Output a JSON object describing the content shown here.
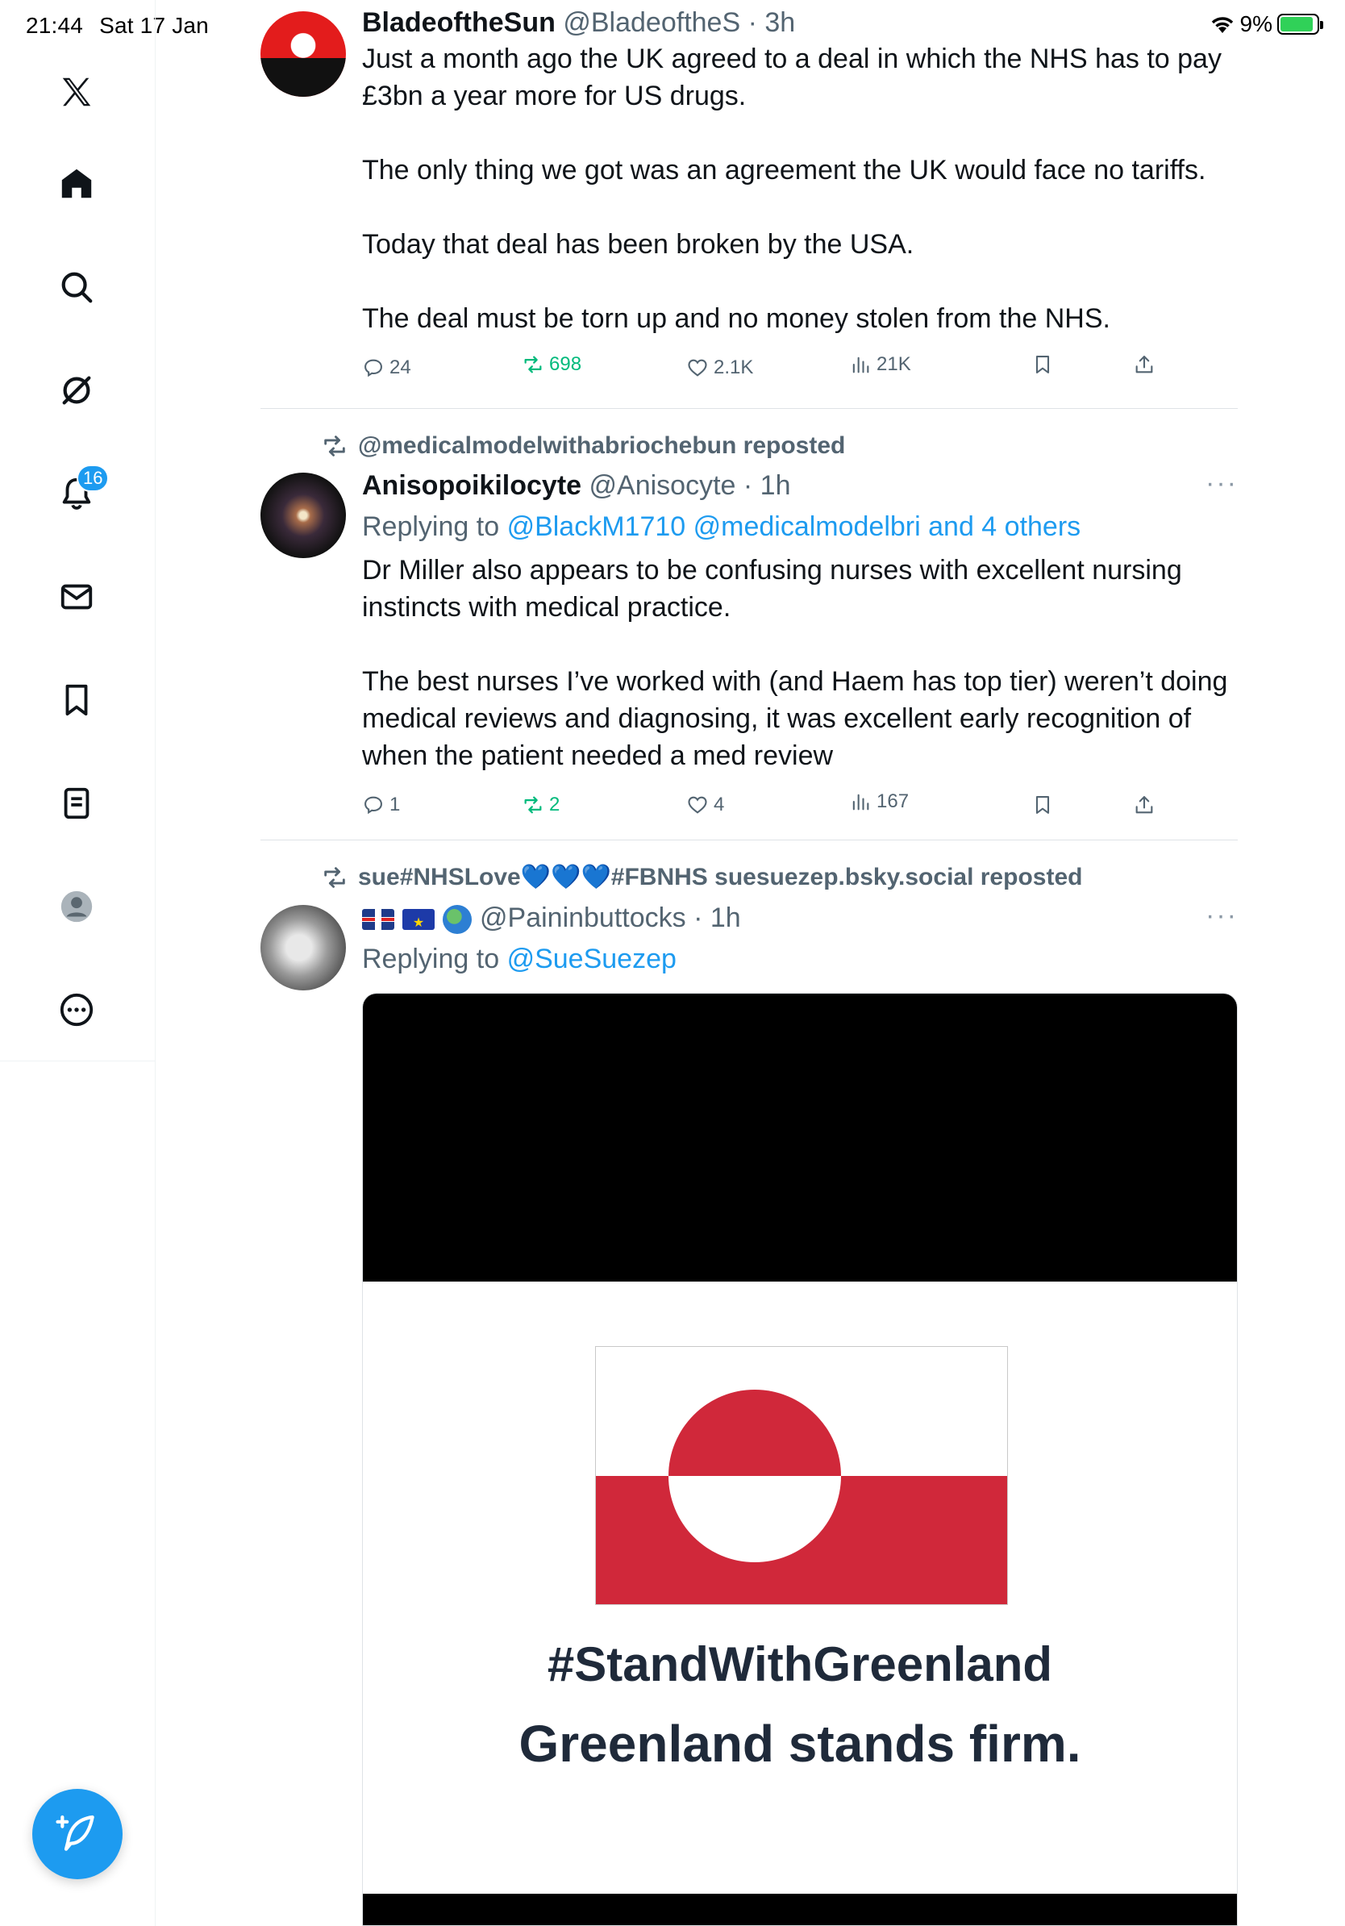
{
  "status_bar": {
    "time": "21:44",
    "date": "Sat 17 Jan",
    "battery": "9%"
  },
  "sidebar": {
    "notifications_badge": "16",
    "items": [
      {
        "name": "x-logo"
      },
      {
        "name": "home"
      },
      {
        "name": "search"
      },
      {
        "name": "grok"
      },
      {
        "name": "notifications"
      },
      {
        "name": "messages"
      },
      {
        "name": "bookmarks"
      },
      {
        "name": "lists"
      },
      {
        "name": "profile"
      },
      {
        "name": "more"
      }
    ]
  },
  "tweets": [
    {
      "name": "BladeoftheSun",
      "handle": "@BladeoftheS",
      "time": "3h",
      "text": [
        "Just a month ago the UK agreed to a deal in which the NHS has to pay £3bn a year more for US drugs.",
        "The only thing we got was an agreement the UK would face no tariffs.",
        "Today that deal has been broken by the USA.",
        "The deal must be torn up and no money stolen from the NHS."
      ],
      "replies": "24",
      "reposts": "698",
      "likes": "2.1K",
      "views": "21K"
    },
    {
      "reposted_by": "@medicalmodelwithabriochebun reposted",
      "name": "Anisopoikilocyte",
      "handle": "@Anisocyte",
      "time": "1h",
      "reply_prefix": "Replying to",
      "reply_mentions": "@BlackM1710 @medicalmodelbri and 4 others",
      "text": [
        "Dr Miller also appears to be confusing nurses with excellent nursing instincts with medical practice.",
        "The best nurses I’ve worked with (and Haem has top tier) weren’t doing medical reviews and diagnosing, it was excellent early recognition of when the patient needed a med review"
      ],
      "replies": "1",
      "reposts": "2",
      "likes": "4",
      "views": "167"
    },
    {
      "reposted_by": "sue#NHSLove💙💙💙#FBNHS suesuezep.bsky.social reposted",
      "handle": "@Paininbuttocks",
      "time": "1h",
      "reply_prefix": "Replying to",
      "reply_mentions": "@SueSuezep",
      "media": {
        "line1": "#StandWithGreenland",
        "line2": "Greenland stands firm."
      }
    }
  ],
  "colors": {
    "accent": "#1d9bf0",
    "repost_green": "#00ba7c",
    "muted": "#536471"
  }
}
